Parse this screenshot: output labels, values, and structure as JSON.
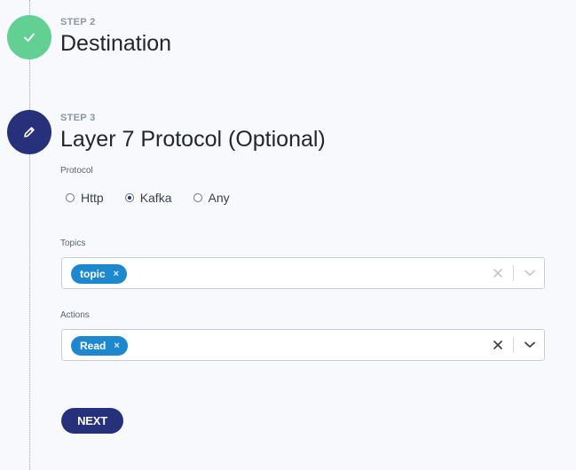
{
  "steps": [
    {
      "caption": "STEP 2",
      "title": "Destination",
      "status": "completed"
    },
    {
      "caption": "STEP 3",
      "title": "Layer 7 Protocol (Optional)",
      "status": "active"
    }
  ],
  "protocol": {
    "label": "Protocol",
    "options": [
      "Http",
      "Kafka",
      "Any"
    ],
    "selected": "Kafka"
  },
  "topics": {
    "label": "Topics",
    "chips": [
      "topic"
    ],
    "chip_remove": "×"
  },
  "actions": {
    "label": "Actions",
    "chips": [
      "Read"
    ],
    "chip_remove": "×"
  },
  "buttons": {
    "next": "NEXT"
  },
  "colors": {
    "completed": "#62cf93",
    "active": "#27307a",
    "chip": "#1e88cf",
    "background": "#f7f9fc"
  },
  "icons": {
    "completed_step": "check-icon",
    "active_step": "pencil-icon",
    "clear": "close-icon",
    "dropdown": "chevron-down-icon"
  }
}
